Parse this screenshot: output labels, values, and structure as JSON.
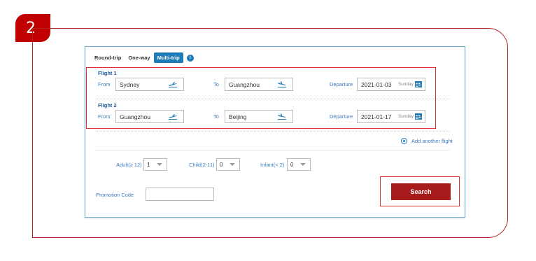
{
  "step": {
    "number": "2"
  },
  "tabs": {
    "round_trip": "Round-trip",
    "one_way": "One-way",
    "multi_trip": "Multi-trip",
    "info_glyph": "i"
  },
  "flights": [
    {
      "title": "Flight 1",
      "from_label": "From",
      "from_value": "Sydney",
      "to_label": "To",
      "to_value": "Guangzhou",
      "departure_label": "Departure",
      "departure_date": "2021-01-03",
      "departure_day": "Sunday"
    },
    {
      "title": "Flight 2",
      "from_label": "From",
      "from_value": "Guangzhou",
      "to_label": "To",
      "to_value": "Beijing",
      "departure_label": "Departure",
      "departure_date": "2021-01-17",
      "departure_day": "Sunday"
    }
  ],
  "add_flight": {
    "label": "Add another flight"
  },
  "passengers": {
    "adult_label": "Adult(≥ 12)",
    "adult_value": "1",
    "child_label": "Child(2-11)",
    "child_value": "0",
    "infant_label": "Infant(< 2)",
    "infant_value": "0"
  },
  "promo": {
    "label": "Promotion Code",
    "value": ""
  },
  "search": {
    "label": "Search"
  },
  "colors": {
    "accent_red": "#c00000",
    "search_red": "#a61b1b",
    "tab_blue": "#1f7ab8",
    "highlight_red": "#e03030"
  },
  "icons": [
    "takeoff-icon",
    "landing-icon",
    "calendar-icon",
    "info-icon",
    "caret-down-icon",
    "radio-icon"
  ]
}
